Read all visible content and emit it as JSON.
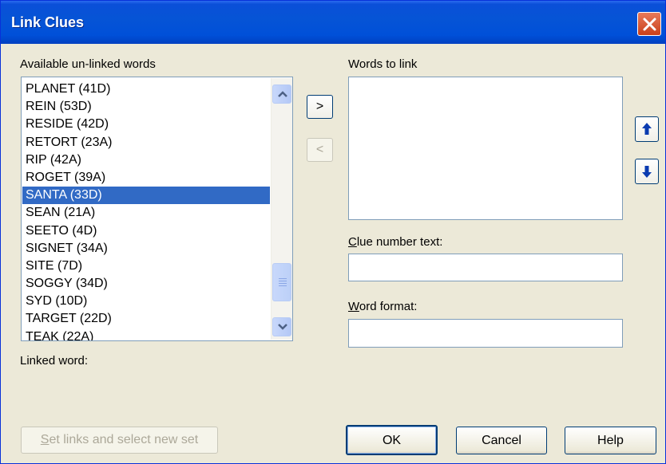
{
  "window": {
    "title": "Link Clues"
  },
  "available": {
    "label": "Available un-linked words",
    "items": [
      "PLANET (41D)",
      "REIN (53D)",
      "RESIDE (42D)",
      "RETORT (23A)",
      "RIP (42A)",
      "ROGET (39A)",
      "SANTA (33D)",
      "SEAN (21A)",
      "SEETO (4D)",
      "SIGNET (34A)",
      "SITE (7D)",
      "SOGGY (34D)",
      "SYD (10D)",
      "TARGET (22D)",
      "TEAK (22A)"
    ],
    "selected_index": 6
  },
  "transfer": {
    "add_label": ">",
    "remove_label": "<"
  },
  "words_to_link": {
    "label": "Words to link",
    "items": []
  },
  "clue_number": {
    "label_first": "C",
    "label_rest": "lue number text:",
    "value": ""
  },
  "word_format": {
    "label_first": "W",
    "label_rest": "ord format:",
    "value": ""
  },
  "linked_word": {
    "label": "Linked word:"
  },
  "buttons": {
    "set_links_first": "S",
    "set_links_rest": "et links and select new set",
    "ok": "OK",
    "cancel": "Cancel",
    "help": "Help"
  },
  "colors": {
    "titlebar": "#0054e3",
    "selection": "#316ac5",
    "dialog": "#ece9d8"
  }
}
